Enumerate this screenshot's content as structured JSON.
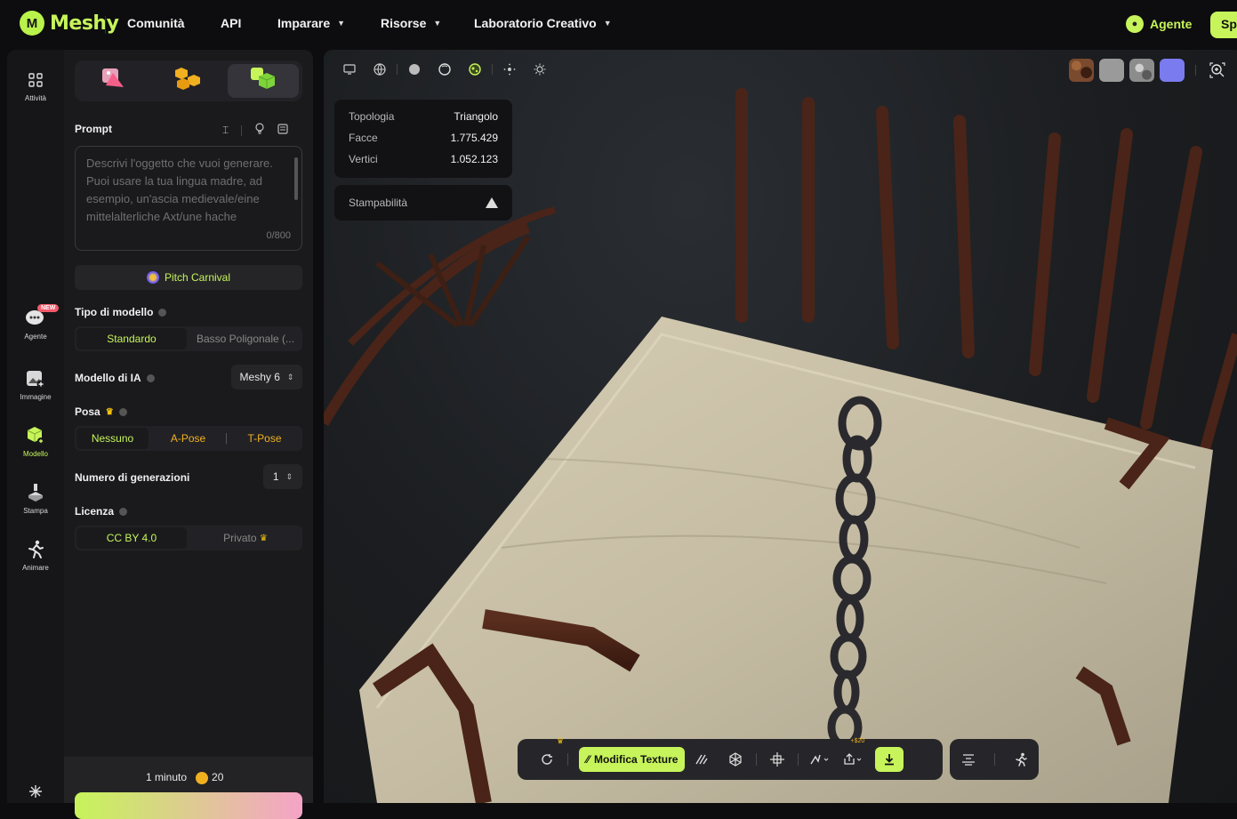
{
  "brand": {
    "name": "Meshy",
    "logo_letter": "M"
  },
  "nav": [
    {
      "label": "Comunità",
      "has_caret": false
    },
    {
      "label": "API",
      "has_caret": false
    },
    {
      "label": "Imparare",
      "has_caret": true
    },
    {
      "label": "Risorse",
      "has_caret": true
    },
    {
      "label": "Laboratorio Creativo",
      "has_caret": true
    }
  ],
  "agent_button": "Agente",
  "sp_button": "Sp",
  "rail": {
    "activity": "Attività",
    "agent": "Agente",
    "agent_badge": "NEW",
    "image": "Immagine",
    "model": "Modello",
    "print": "Stampa",
    "animate": "Animare"
  },
  "panel": {
    "prompt_label": "Prompt",
    "prompt_placeholder": "Descrivi l'oggetto che vuoi generare. Puoi usare la tua lingua madre, ad esempio, un'ascia medievale/eine mittelalterliche Axt/une hache",
    "prompt_counter": "0/800",
    "pitch_label": "Pitch Carnival",
    "model_type_label": "Tipo di modello",
    "model_type_options": [
      "Standardo",
      "Basso Poligonale (..."
    ],
    "ai_model_label": "Modello di IA",
    "ai_model_value": "Meshy 6",
    "pose_label": "Posa",
    "pose_options": [
      "Nessuno",
      "A-Pose",
      "T-Pose"
    ],
    "generations_label": "Numero di generazioni",
    "generations_value": "1",
    "license_label": "Licenza",
    "license_options": [
      "CC BY 4.0",
      "Privato"
    ],
    "time_estimate": "1 minuto",
    "credit_cost": "20"
  },
  "viewport": {
    "stats": [
      {
        "key": "Topologia",
        "value": "Triangolo"
      },
      {
        "key": "Facce",
        "value": "1.775.429"
      },
      {
        "key": "Vertici",
        "value": "1.052.123"
      }
    ],
    "printability_label": "Stampabilità",
    "swatch_colors": [
      "#7a4a2e",
      "#9a9a9a",
      "#8c8c8c",
      "#7b7bf0"
    ],
    "toolbar": {
      "edit_texture_label": "Modifica Texture",
      "price_tag": "+$20"
    }
  },
  "colors": {
    "accent": "#c6f45a",
    "gold": "#f4c20d",
    "alert": "#f25a6b"
  }
}
